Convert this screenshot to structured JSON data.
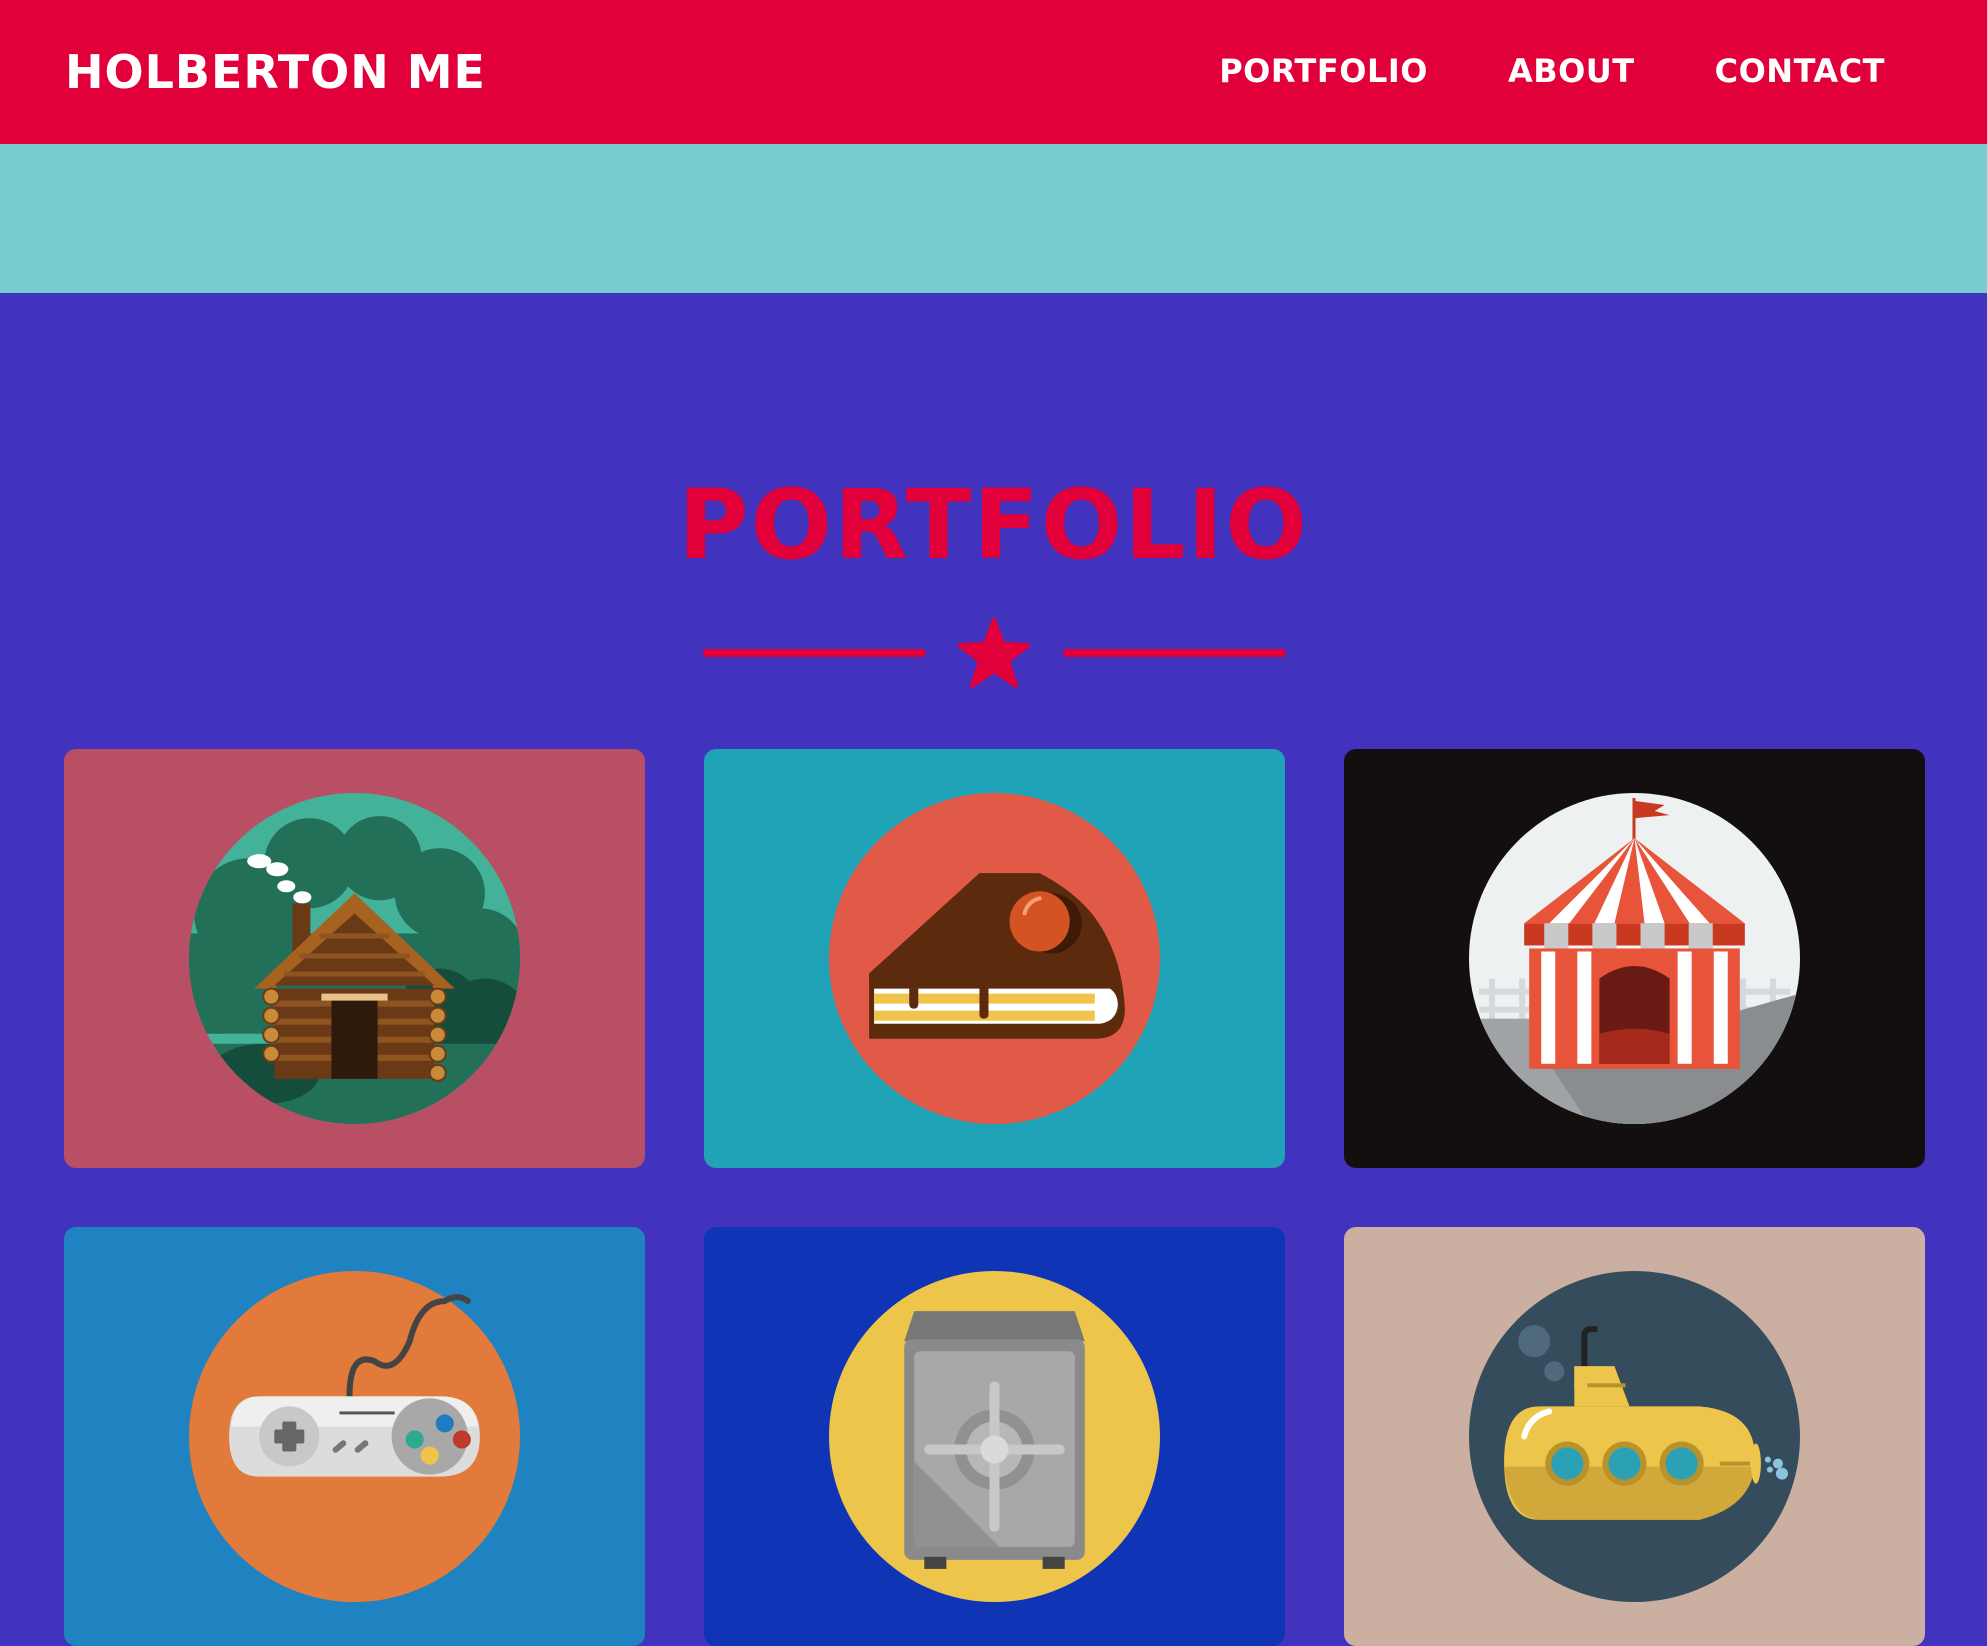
{
  "header": {
    "brand": "HOLBERTON ME",
    "nav": [
      {
        "label": "PORTFOLIO"
      },
      {
        "label": "ABOUT"
      },
      {
        "label": "CONTACT"
      }
    ]
  },
  "portfolio": {
    "title": "PORTFOLIO",
    "items": [
      {
        "icon": "log-cabin-icon",
        "bg": "#b94f64",
        "circle": "#44b199"
      },
      {
        "icon": "cake-slice-icon",
        "bg": "#21a3b7",
        "circle": "#e05a47"
      },
      {
        "icon": "circus-tent-icon",
        "bg": "#130f0e",
        "circle": "#eef1f2"
      },
      {
        "icon": "game-controller-icon",
        "bg": "#1f83c2",
        "circle": "#e27a3c"
      },
      {
        "icon": "safe-icon",
        "bg": "#0f35b6",
        "circle": "#ecc54a"
      },
      {
        "icon": "submarine-icon",
        "bg": "#cbafa1",
        "circle": "#354c5c"
      }
    ]
  },
  "colors": {
    "navbar": "#e2003a",
    "hero": "#78cdd1",
    "page": "#4133bd",
    "accent": "#e2003a"
  }
}
